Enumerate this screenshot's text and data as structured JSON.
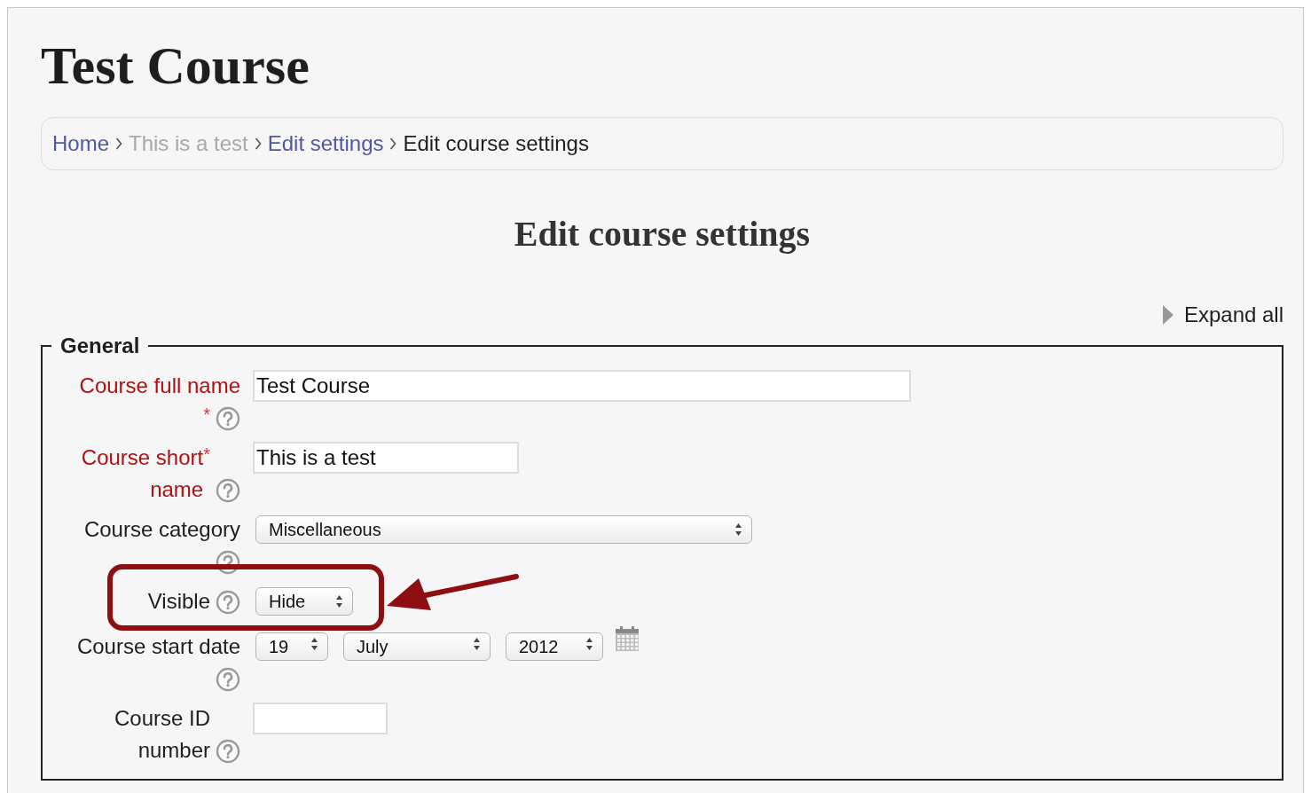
{
  "page_title": "Test Course",
  "breadcrumb": [
    {
      "label": "Home",
      "link": true,
      "dimmed": false
    },
    {
      "label": "This is a test",
      "link": true,
      "dimmed": true
    },
    {
      "label": "Edit settings",
      "link": true,
      "dimmed": false
    },
    {
      "label": "Edit course settings",
      "link": false,
      "dimmed": false
    }
  ],
  "heading": "Edit course settings",
  "expand_all": "Expand all",
  "section": {
    "legend": "General",
    "fields": [
      {
        "kind": "text",
        "label": "Course full name",
        "required_mark": "*",
        "value": "Test Course"
      },
      {
        "kind": "text",
        "label": "Course short name",
        "required_mark": "*",
        "value": "This is a test"
      },
      {
        "kind": "select",
        "label": "Course category",
        "value": "Miscellaneous"
      },
      {
        "kind": "select",
        "label": "Visible",
        "value": "Hide"
      },
      {
        "kind": "date",
        "label": "Course start date",
        "parts": [
          "19",
          "July",
          "2012"
        ]
      },
      {
        "kind": "text",
        "label": "Course ID number"
      }
    ]
  }
}
